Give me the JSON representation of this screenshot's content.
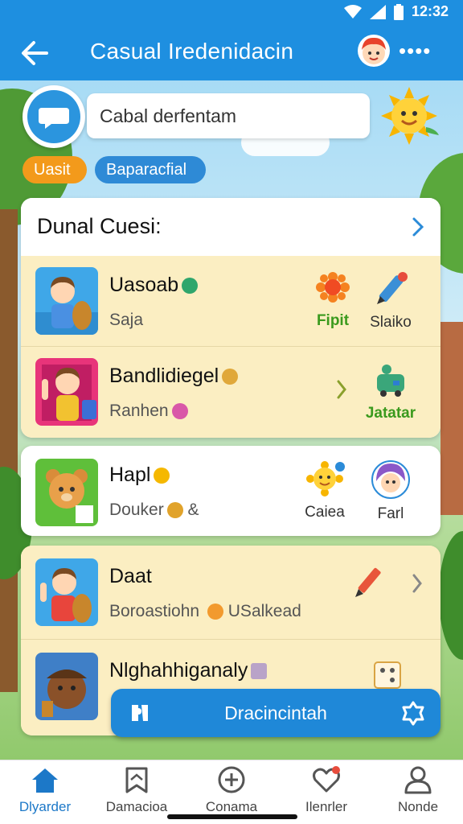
{
  "status_bar": {
    "time": "12:32"
  },
  "header": {
    "title": "Casual Iredenidacin",
    "more": "••••"
  },
  "search": {
    "value": "Cabal derfentam"
  },
  "chips": [
    {
      "label": "Uasit",
      "color": "#f39a1b"
    },
    {
      "label": "Baparacfial",
      "color": "#2e8ad6"
    }
  ],
  "section": {
    "title": "Dunal Cuesi:"
  },
  "items": [
    {
      "title": "Uasoab",
      "subtitle": "Saja",
      "side1": "Fipit",
      "side2": "Slaiko"
    },
    {
      "title": "Bandlidiegel",
      "subtitle": "Ranhen",
      "side1": "",
      "side2": "Jatatar"
    },
    {
      "title": "Hapl",
      "subtitle": "Douker",
      "subtitle_suffix": "&",
      "side1": "Caiea",
      "side2": "Farl"
    },
    {
      "title": "Daat",
      "subtitle": "Boroastiohn",
      "subtitle_suffix": "USalkead",
      "side1": "",
      "side2": ""
    },
    {
      "title": "Nlghahhiganaly",
      "subtitle": "",
      "side1": "",
      "side2": ""
    }
  ],
  "fab": {
    "label": "Dracincintah"
  },
  "nav": [
    {
      "label": "Dlyarder",
      "icon": "home-icon"
    },
    {
      "label": "Damacioa",
      "icon": "bookmark-icon"
    },
    {
      "label": "Conama",
      "icon": "plus-circle-icon"
    },
    {
      "label": "Ilenrler",
      "icon": "heart-icon"
    },
    {
      "label": "Nonde",
      "icon": "person-icon"
    }
  ],
  "colors": {
    "primary": "#1e8fe0",
    "card": "#fbeec2",
    "accent_green": "#3a9a1d",
    "chip_orange": "#f39a1b"
  }
}
